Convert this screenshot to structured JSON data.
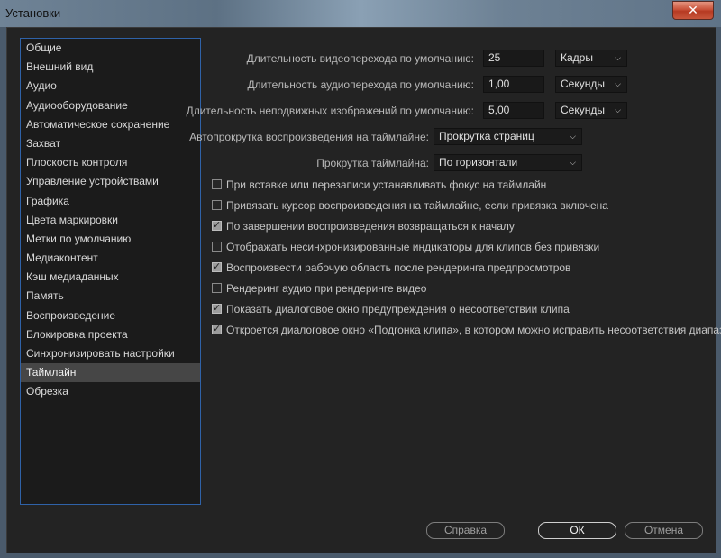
{
  "window": {
    "title": "Установки",
    "close_icon": "✕"
  },
  "sidebar": {
    "items": [
      {
        "label": "Общие"
      },
      {
        "label": "Внешний вид"
      },
      {
        "label": "Аудио"
      },
      {
        "label": "Аудиооборудование"
      },
      {
        "label": "Автоматическое сохранение"
      },
      {
        "label": "Захват"
      },
      {
        "label": "Плоскость контроля"
      },
      {
        "label": "Управление устройствами"
      },
      {
        "label": "Графика"
      },
      {
        "label": "Цвета маркировки"
      },
      {
        "label": "Метки по умолчанию"
      },
      {
        "label": "Медиаконтент"
      },
      {
        "label": "Кэш медиаданных"
      },
      {
        "label": "Память"
      },
      {
        "label": "Воспроизведение"
      },
      {
        "label": "Блокировка проекта"
      },
      {
        "label": "Синхронизировать настройки"
      },
      {
        "label": "Таймлайн",
        "selected": true
      },
      {
        "label": "Обрезка"
      }
    ]
  },
  "settings": {
    "video_transition": {
      "label": "Длительность видеоперехода по умолчанию:",
      "value": "25",
      "unit": "Кадры"
    },
    "audio_transition": {
      "label": "Длительность аудиоперехода по умолчанию:",
      "value": "1,00",
      "unit": "Секунды"
    },
    "still_image": {
      "label": "Длительность неподвижных изображений по умолчанию:",
      "value": "5,00",
      "unit": "Секунды"
    },
    "autoscroll": {
      "label": "Автопрокрутка воспроизведения на таймлайне:",
      "value": "Прокрутка страниц"
    },
    "timeline_scroll": {
      "label": "Прокрутка таймлайна:",
      "value": "По горизонтали"
    },
    "chevron": "⌵"
  },
  "checkboxes": [
    {
      "label": "При вставке или перезаписи устанавливать фокус на таймлайн",
      "checked": false
    },
    {
      "label": "Привязать курсор воспроизведения на таймлайне, если привязка включена",
      "checked": false
    },
    {
      "label": "По завершении воспроизведения возвращаться к началу",
      "checked": true
    },
    {
      "label": "Отображать несинхронизированные индикаторы для клипов без привязки",
      "checked": false
    },
    {
      "label": "Воспроизвести рабочую область после рендеринга предпросмотров",
      "checked": true
    },
    {
      "label": "Рендеринг аудио при рендеринге видео",
      "checked": false
    },
    {
      "label": "Показать диалоговое окно предупреждения о несоответствии клипа",
      "checked": true
    },
    {
      "label": "Откроется диалоговое окно «Подгонка клипа», в котором можно исправить несоответствия диапазона",
      "checked": true
    }
  ],
  "buttons": {
    "help": "Справка",
    "ok": "ОК",
    "cancel": "Отмена"
  }
}
